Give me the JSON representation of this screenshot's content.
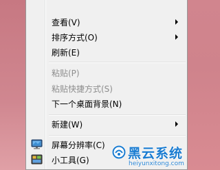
{
  "menu": {
    "items": [
      {
        "label": "查看(V)",
        "has_submenu": true,
        "disabled": false
      },
      {
        "label": "排序方式(O)",
        "has_submenu": true,
        "disabled": false
      },
      {
        "label": "刷新(E)",
        "has_submenu": false,
        "disabled": false
      },
      {
        "label": "粘贴(P)",
        "has_submenu": false,
        "disabled": true
      },
      {
        "label": "粘贴快捷方式(S)",
        "has_submenu": false,
        "disabled": true
      },
      {
        "label": "下一个桌面背景(N)",
        "has_submenu": false,
        "disabled": false
      },
      {
        "label": "新建(W)",
        "has_submenu": true,
        "disabled": false
      },
      {
        "label": "屏幕分辨率(C)",
        "has_submenu": false,
        "disabled": false,
        "icon": "monitor-icon"
      },
      {
        "label": "小工具(G)",
        "has_submenu": false,
        "disabled": false,
        "icon": "gadgets-icon"
      }
    ]
  },
  "watermark": {
    "brand": "黑云系统",
    "url": "heiyunxitong.com"
  },
  "colors": {
    "desktop": "#d1858e",
    "menu_bg": "#f0f0f0",
    "disabled_text": "#8d8d8d",
    "watermark_blue": "#1a7cd1"
  }
}
